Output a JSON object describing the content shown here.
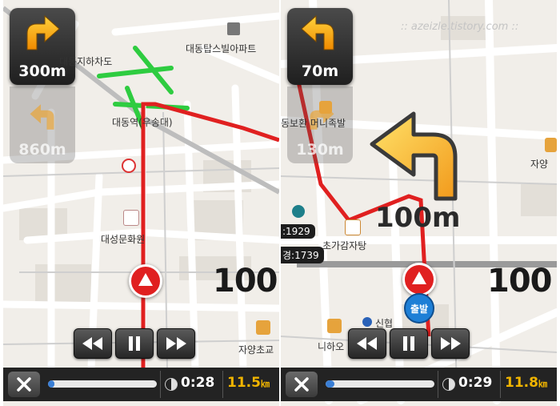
{
  "left": {
    "turn_current": {
      "distance": "300m",
      "icon": "turn-right-arrow-icon"
    },
    "turn_next": {
      "distance": "860m",
      "icon": "turn-left-arrow-icon"
    },
    "pois": {
      "underpass": "대동지하차도",
      "apartment": "대동탑스빌아파트",
      "station": "대동역(우송대)",
      "hall": "대성문화원",
      "school": "자양초교"
    },
    "speed_limit": "100",
    "playback": {
      "elapsed": "0:28",
      "distance": "11.5",
      "unit": "㎞",
      "progress": 0.06
    }
  },
  "right": {
    "turn_current": {
      "distance": "70m",
      "icon": "turn-left-arrow-icon"
    },
    "turn_next": {
      "distance": "130m",
      "icon": "turn-right-arrow-icon"
    },
    "big_turn": {
      "distance": "100m",
      "icon": "big-turn-left-arrow-icon"
    },
    "watermark": ":: azeizle.tistory.com ::",
    "pois": {
      "shop": "동보환 머니족발",
      "restaurant": "초가감자탕",
      "bank": "신협",
      "hotel": "니하오",
      "right_edge": "자양"
    },
    "side_tags": [
      ":1929",
      "경:1739"
    ],
    "start_label": "출발",
    "speed_limit": "100",
    "playback": {
      "elapsed": "0:29",
      "distance": "11.8",
      "unit": "㎞",
      "progress": 0.08
    }
  },
  "colors": {
    "route": "#e02020",
    "road_green": "#2ecc40",
    "distance_yellow": "#f0b400",
    "progress_blue": "#3a7fd6"
  }
}
